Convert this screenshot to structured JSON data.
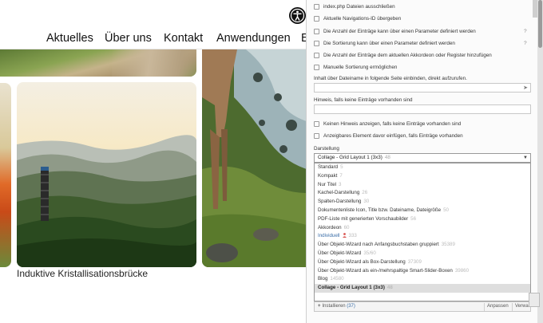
{
  "website": {
    "nav": [
      "Aktuelles",
      "Über uns",
      "Kontakt",
      "Anwendungen",
      "E"
    ],
    "caption": "Induktive Kristallisationsbrücke"
  },
  "panel": {
    "checkbox_rows": [
      {
        "label": "index.php Dateien ausschließen",
        "help": ""
      },
      {
        "label": "Aktuelle Navigations-ID übergeben",
        "help": ""
      },
      {
        "label": "Die Anzahl der Einträge kann über einen Parameter definiert werden",
        "help": "?"
      },
      {
        "label": "Die Sortierung kann über einen Parameter definiert werden",
        "help": "?"
      },
      {
        "label": "Die Anzahl der Einträge dem aktuellen Akkordeon oder Register hinzufügen",
        "help": ""
      },
      {
        "label": "Manuelle Sortierung ermöglichen",
        "help": ""
      }
    ],
    "include_label": "Inhalt über Dateiname in folgende Seite einbinden, direkt aufzurufen.",
    "include_value": "",
    "include_icon": "paper-plane-icon",
    "empty_hint_label": "Hinweis, falls keine Einträge vorhanden sind",
    "empty_hint_value": "",
    "checkbox_rows2": [
      {
        "label": "Keinen Hinweis anzeigen, falls keine Einträge vorhanden sind"
      },
      {
        "label": "Anzeigbares Element davor einfügen, falls Einträge vorhanden"
      }
    ],
    "display_label": "Darstellung",
    "select_value": "Collage - Grid Layout 1 (3x3)",
    "select_count": "48",
    "options": [
      {
        "label": "Standard",
        "count": "5",
        "style": ""
      },
      {
        "label": "Kompakt",
        "count": "7",
        "style": ""
      },
      {
        "label": "Nur Titel",
        "count": "3",
        "style": ""
      },
      {
        "label": "Kachel-Darstellung",
        "count": "26",
        "style": ""
      },
      {
        "label": "Spalten-Darstellung",
        "count": "30",
        "style": ""
      },
      {
        "label": "Dokumentenliste Icon, Title bzw. Dateiname, Dateigröße",
        "count": "50",
        "style": ""
      },
      {
        "label": "PDF-Liste mit generierten Vorschaubilder",
        "count": "56",
        "style": ""
      },
      {
        "label": "Akkordeon",
        "count": "60",
        "style": ""
      },
      {
        "label": "Individuell",
        "count": "333",
        "style": "blue",
        "user": true
      },
      {
        "label": "Über Objekt-Wizard nach Anfangsbuchstaben gruppiert",
        "count": "35389",
        "style": ""
      },
      {
        "label": "Über Objekt-Wizard",
        "count": "35/60",
        "style": ""
      },
      {
        "label": "Über Objekt-Wizard als Box-Darstellung",
        "count": "37309",
        "style": ""
      },
      {
        "label": "Über Objekt-Wizard als ein-/mehrspaltige Smart-Slider-Boxen",
        "count": "39860",
        "style": ""
      },
      {
        "label": "Blog",
        "count": "14580",
        "style": ""
      },
      {
        "label": "Collage - Grid Layout 1 (3x3)",
        "count": "48",
        "style": "sel"
      }
    ],
    "footer": {
      "install_label": "Installieren",
      "install_count": "(37)",
      "apply_label": "Anpassen",
      "manage_label": "Verwalten"
    }
  },
  "colors": {
    "link_blue": "#3b6ea8",
    "selected_bg": "#dedede"
  }
}
